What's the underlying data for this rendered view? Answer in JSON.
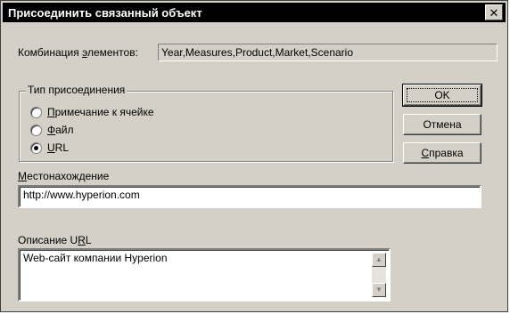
{
  "window": {
    "title": "Присоединить связанный объект",
    "close_glyph": "✕"
  },
  "combination": {
    "label_prefix": "Комбинация ",
    "label_mnemonic": "э",
    "label_suffix": "лементов:",
    "value": "Year,Measures,Product,Market,Scenario"
  },
  "attach_type": {
    "title": "Тип присоединения",
    "options": [
      {
        "mnemonic": "П",
        "rest": "римечание к ячейке",
        "selected": false
      },
      {
        "mnemonic": "Ф",
        "rest": "айл",
        "selected": false
      },
      {
        "mnemonic": "U",
        "rest": "RL",
        "selected": true
      }
    ]
  },
  "buttons": {
    "ok": "OK",
    "cancel": "Отмена",
    "help_mnemonic": "С",
    "help_rest": "правка"
  },
  "location": {
    "label_mnemonic": "М",
    "label_rest": "естонахождение",
    "value": "http://www.hyperion.com"
  },
  "description": {
    "label_prefix": "Описание U",
    "label_mnemonic": "R",
    "label_suffix": "L",
    "value": "Web-сайт компании Hyperion"
  },
  "icons": {
    "close": "close-icon",
    "scroll_up": "arrow-up-icon",
    "scroll_down": "arrow-down-icon"
  }
}
